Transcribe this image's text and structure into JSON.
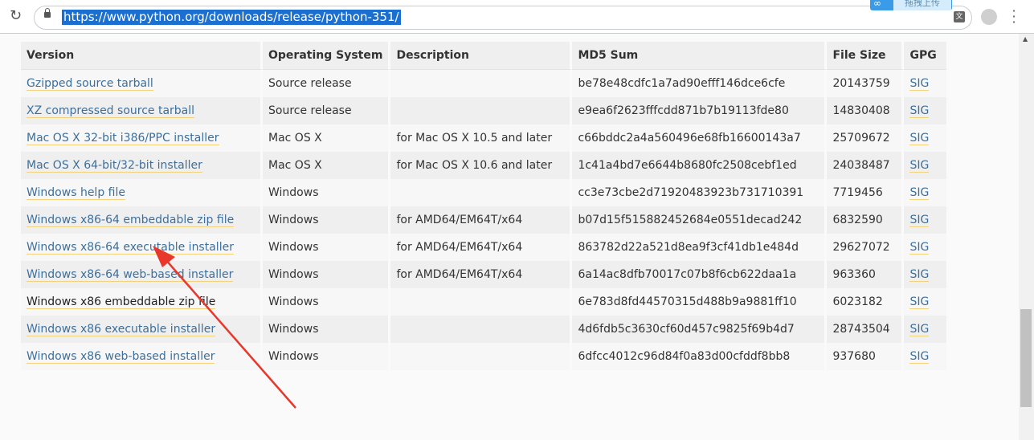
{
  "browser": {
    "url": "https://www.python.org/downloads/release/python-351/",
    "upload_widget_label": "拖拽上传"
  },
  "table": {
    "headers": [
      "Version",
      "Operating System",
      "Description",
      "MD5 Sum",
      "File Size",
      "GPG"
    ],
    "rows": [
      {
        "version": "Gzipped source tarball",
        "os": "Source release",
        "description": "",
        "md5": "be78e48cdfc1a7ad90efff146dce6cfe",
        "size": "20143759",
        "gpg": "SIG"
      },
      {
        "version": "XZ compressed source tarball",
        "os": "Source release",
        "description": "",
        "md5": "e9ea6f2623fffcdd871b7b19113fde80",
        "size": "14830408",
        "gpg": "SIG"
      },
      {
        "version": "Mac OS X 32-bit i386/PPC installer",
        "os": "Mac OS X",
        "description": "for Mac OS X 10.5 and later",
        "md5": "c66bddc2a4a560496e68fb16600143a7",
        "size": "25709672",
        "gpg": "SIG"
      },
      {
        "version": "Mac OS X 64-bit/32-bit installer",
        "os": "Mac OS X",
        "description": "for Mac OS X 10.6 and later",
        "md5": "1c41a4bd7e6644b8680fc2508cebf1ed",
        "size": "24038487",
        "gpg": "SIG"
      },
      {
        "version": "Windows help file",
        "os": "Windows",
        "description": "",
        "md5": "cc3e73cbe2d71920483923b731710391",
        "size": "7719456",
        "gpg": "SIG"
      },
      {
        "version": "Windows x86-64 embeddable zip file",
        "os": "Windows",
        "description": "for AMD64/EM64T/x64",
        "md5": "b07d15f515882452684e0551decad242",
        "size": "6832590",
        "gpg": "SIG"
      },
      {
        "version": "Windows x86-64 executable installer",
        "os": "Windows",
        "description": "for AMD64/EM64T/x64",
        "md5": "863782d22a521d8ea9f3cf41db1e484d",
        "size": "29627072",
        "gpg": "SIG"
      },
      {
        "version": "Windows x86-64 web-based installer",
        "os": "Windows",
        "description": "for AMD64/EM64T/x64",
        "md5": "6a14ac8dfb70017c07b8f6cb622daa1a",
        "size": "963360",
        "gpg": "SIG"
      },
      {
        "version": "Windows x86 embeddable zip file",
        "os": "Windows",
        "description": "",
        "md5": "6e783d8fd44570315d488b9a9881ff10",
        "size": "6023182",
        "gpg": "SIG"
      },
      {
        "version": "Windows x86 executable installer",
        "os": "Windows",
        "description": "",
        "md5": "4d6fdb5c3630cf60d457c9825f69b4d7",
        "size": "28743504",
        "gpg": "SIG"
      },
      {
        "version": "Windows x86 web-based installer",
        "os": "Windows",
        "description": "",
        "md5": "6dfcc4012c96d84f0a83d00cfddf8bb8",
        "size": "937680",
        "gpg": "SIG"
      }
    ]
  },
  "annotation": {
    "color": "#e8382c",
    "points_to": "Windows x86-64 executable installer"
  }
}
